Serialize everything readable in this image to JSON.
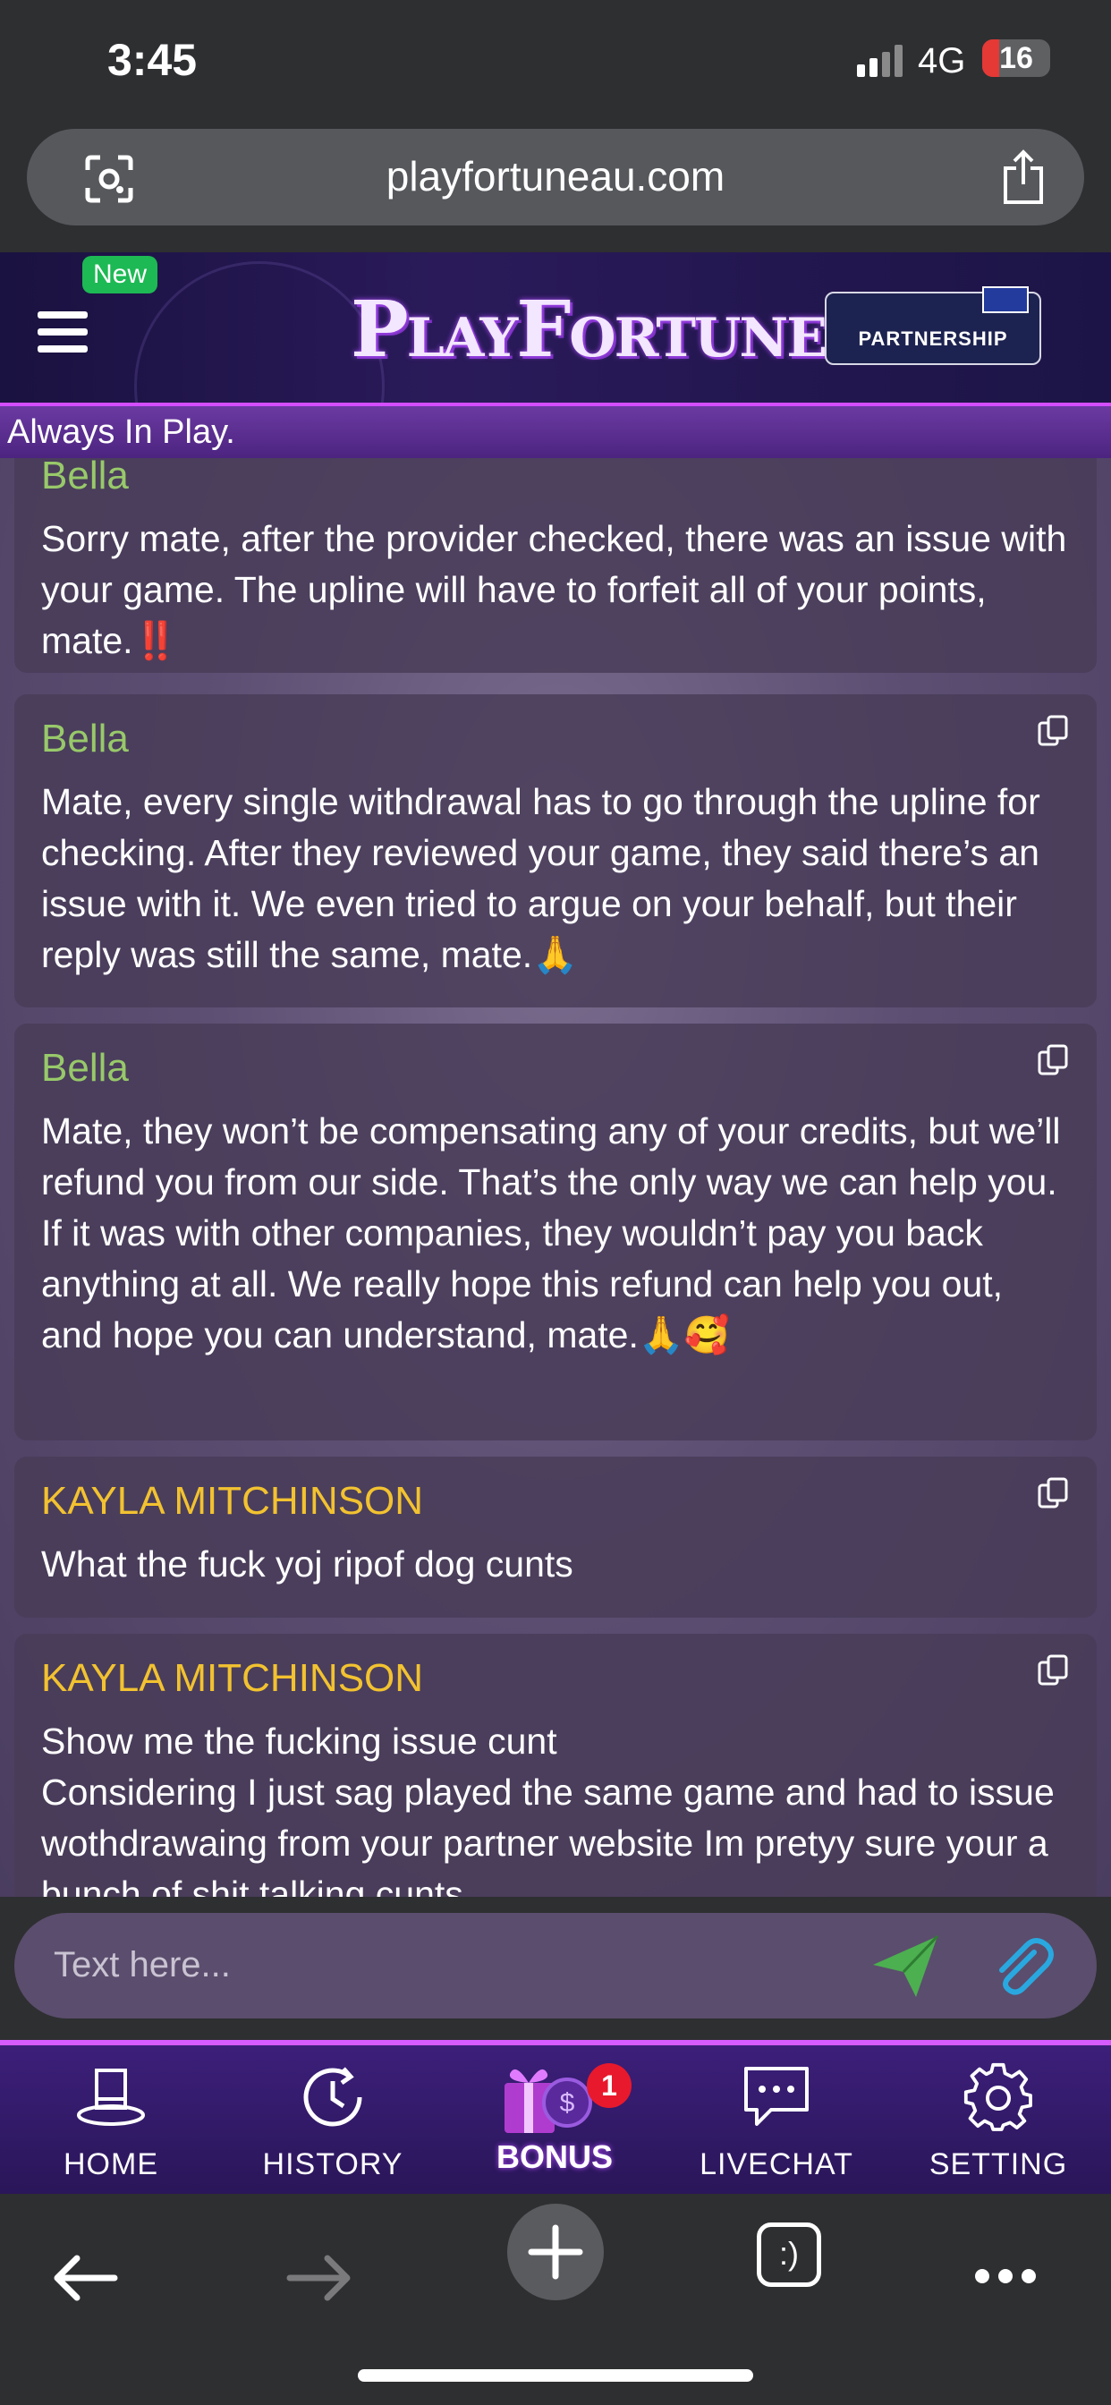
{
  "status_bar": {
    "time": "3:45",
    "network": "4G",
    "battery_level": "16",
    "battery_fraction": 0.16
  },
  "browser": {
    "url": "playfortuneau.com"
  },
  "site": {
    "new_badge": "New",
    "logo_text": "PlayFortune",
    "partner_badge": "PARTNERSHIP",
    "tagline": "Always In Play."
  },
  "messages": [
    {
      "sender": "Bella",
      "role": "agent",
      "text": "Sorry mate, after the provider checked, there was an issue with your game. The upline will have to forfeit all of your points, mate.‼️"
    },
    {
      "sender": "Bella",
      "role": "agent",
      "text": "Mate, every single withdrawal has to go through the upline for checking. After they reviewed your game, they said there’s an issue with it. We even tried to argue on your behalf, but their reply was still the same, mate.🙏"
    },
    {
      "sender": "Bella",
      "role": "agent",
      "text": "Mate, they won’t be compensating any of your credits, but we’ll refund you from our side. That’s the only way we can help you. If it was with other companies, they wouldn’t pay you back anything at all. We really hope this refund can help you out, and hope you can understand, mate.🙏🥰"
    },
    {
      "sender": "KAYLA MITCHINSON",
      "role": "user",
      "text": "What the fuck yoj ripof dog cunts"
    },
    {
      "sender": "KAYLA MITCHINSON",
      "role": "user",
      "text": "Show me the fucking issue cunt\nConsidering I just sag played the same game and had to issue wothdrawaing from your partner website Im pretyy sure your a bunch of shit talking cunts"
    }
  ],
  "chat_input": {
    "placeholder": "Text here..."
  },
  "bottom_nav": {
    "items": [
      {
        "label": "HOME",
        "icon": "top-hat-icon"
      },
      {
        "label": "HISTORY",
        "icon": "history-clock-icon"
      },
      {
        "label": "BONUS",
        "icon": "gift-box-icon",
        "badge": "1"
      },
      {
        "label": "LIVECHAT",
        "icon": "chat-bubble-icon"
      },
      {
        "label": "SETTING",
        "icon": "gear-icon"
      }
    ]
  },
  "browser_toolbar": {
    "tabs_label": ":)"
  },
  "colors": {
    "agent_name": "#98c96a",
    "user_name": "#f2c230",
    "send_icon": "#4caf50",
    "attach_icon": "#29a8e0",
    "badge_red": "#e8192c",
    "nav_accent": "#d65cff"
  }
}
